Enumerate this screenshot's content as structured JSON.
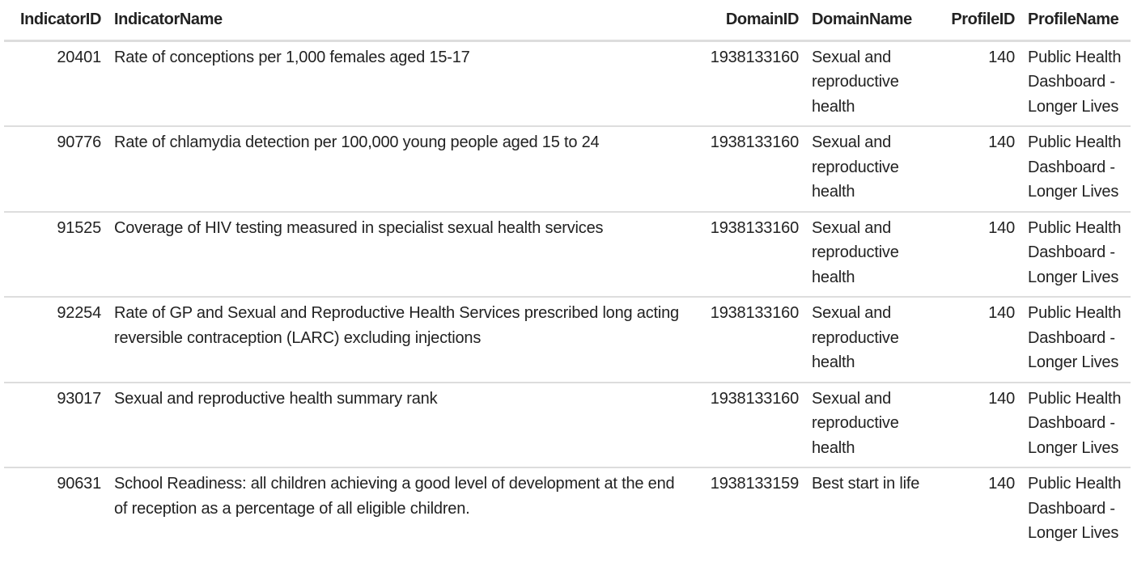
{
  "table": {
    "headers": {
      "indicator_id": "IndicatorID",
      "indicator_name": "IndicatorName",
      "domain_id": "DomainID",
      "domain_name": "DomainName",
      "profile_id": "ProfileID",
      "profile_name": "ProfileName"
    },
    "rows": [
      {
        "indicator_id": "20401",
        "indicator_name": "Rate of conceptions per 1,000 females aged 15-17",
        "domain_id": "1938133160",
        "domain_name": "Sexual and reproductive health",
        "profile_id": "140",
        "profile_name": "Public Health Dashboard - Longer Lives"
      },
      {
        "indicator_id": "90776",
        "indicator_name": "Rate of chlamydia detection per 100,000 young people aged 15 to 24",
        "domain_id": "1938133160",
        "domain_name": "Sexual and reproductive health",
        "profile_id": "140",
        "profile_name": "Public Health Dashboard - Longer Lives"
      },
      {
        "indicator_id": "91525",
        "indicator_name": "Coverage of HIV testing measured in specialist sexual health services",
        "domain_id": "1938133160",
        "domain_name": "Sexual and reproductive health",
        "profile_id": "140",
        "profile_name": "Public Health Dashboard - Longer Lives"
      },
      {
        "indicator_id": "92254",
        "indicator_name": "Rate of GP and Sexual and Reproductive Health Services prescribed long acting reversible contraception (LARC) excluding injections",
        "domain_id": "1938133160",
        "domain_name": "Sexual and reproductive health",
        "profile_id": "140",
        "profile_name": "Public Health Dashboard - Longer Lives"
      },
      {
        "indicator_id": "93017",
        "indicator_name": "Sexual and reproductive health summary rank",
        "domain_id": "1938133160",
        "domain_name": "Sexual and reproductive health",
        "profile_id": "140",
        "profile_name": "Public Health Dashboard - Longer Lives"
      },
      {
        "indicator_id": "90631",
        "indicator_name": "School Readiness: all children achieving a good level of development at the end of reception as a percentage of all eligible children.",
        "domain_id": "1938133159",
        "domain_name": "Best start in life",
        "profile_id": "140",
        "profile_name": "Public Health Dashboard - Longer Lives"
      }
    ]
  }
}
